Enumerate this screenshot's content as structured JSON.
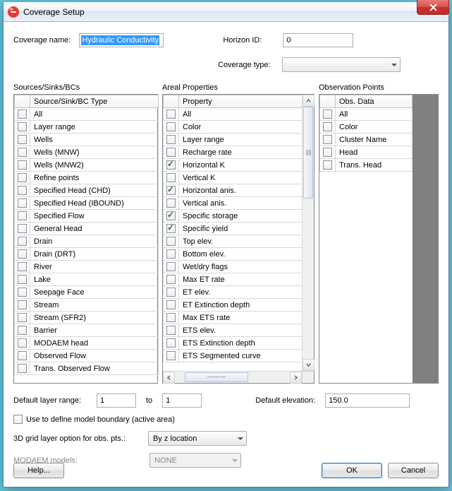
{
  "window": {
    "title": "Coverage Setup"
  },
  "fields": {
    "coverage_name_label": "Coverage name:",
    "coverage_name_value": "Hydraulic Conductivity",
    "horizon_id_label": "Horizon ID:",
    "horizon_id_value": "0",
    "coverage_type_label": "Coverage type:",
    "coverage_type_value": ""
  },
  "sections": {
    "sources": {
      "title": "Sources/Sinks/BCs",
      "header": "Source/Sink/BC Type",
      "items": [
        {
          "label": "All",
          "checked": false
        },
        {
          "label": "Layer range",
          "checked": false
        },
        {
          "label": "Wells",
          "checked": false
        },
        {
          "label": "Wells (MNW)",
          "checked": false
        },
        {
          "label": "Wells (MNW2)",
          "checked": false
        },
        {
          "label": "Refine points",
          "checked": false
        },
        {
          "label": "Specified Head (CHD)",
          "checked": false
        },
        {
          "label": "Specified Head (IBOUND)",
          "checked": false
        },
        {
          "label": "Specified Flow",
          "checked": false
        },
        {
          "label": "General Head",
          "checked": false
        },
        {
          "label": "Drain",
          "checked": false
        },
        {
          "label": "Drain (DRT)",
          "checked": false
        },
        {
          "label": "River",
          "checked": false
        },
        {
          "label": "Lake",
          "checked": false
        },
        {
          "label": "Seepage Face",
          "checked": false
        },
        {
          "label": "Stream",
          "checked": false
        },
        {
          "label": "Stream (SFR2)",
          "checked": false
        },
        {
          "label": "Barrier",
          "checked": false
        },
        {
          "label": "MODAEM head",
          "checked": false
        },
        {
          "label": "Observed Flow",
          "checked": false
        },
        {
          "label": "Trans. Observed Flow",
          "checked": false
        }
      ]
    },
    "areal": {
      "title": "Areal Properties",
      "header": "Property",
      "items": [
        {
          "label": "All",
          "checked": false
        },
        {
          "label": "Color",
          "checked": false
        },
        {
          "label": "Layer range",
          "checked": false
        },
        {
          "label": "Recharge rate",
          "checked": false
        },
        {
          "label": "Horizontal K",
          "checked": true
        },
        {
          "label": "Vertical K",
          "checked": false
        },
        {
          "label": "Horizontal anis.",
          "checked": true
        },
        {
          "label": "Vertical anis.",
          "checked": false
        },
        {
          "label": "Specific storage",
          "checked": true
        },
        {
          "label": "Specific yield",
          "checked": true
        },
        {
          "label": "Top elev.",
          "checked": false
        },
        {
          "label": "Bottom elev.",
          "checked": false
        },
        {
          "label": "Wet/dry flags",
          "checked": false
        },
        {
          "label": "Max ET rate",
          "checked": false
        },
        {
          "label": "ET elev.",
          "checked": false
        },
        {
          "label": "ET Extinction depth",
          "checked": false
        },
        {
          "label": "Max ETS rate",
          "checked": false
        },
        {
          "label": "ETS elev.",
          "checked": false
        },
        {
          "label": "ETS Extinction depth",
          "checked": false
        },
        {
          "label": "ETS Segmented curve",
          "checked": false
        }
      ]
    },
    "obs": {
      "title": "Observation Points",
      "header": "Obs. Data",
      "items": [
        {
          "label": "All",
          "checked": false
        },
        {
          "label": "Color",
          "checked": false
        },
        {
          "label": "Cluster Name",
          "checked": false
        },
        {
          "label": "Head",
          "checked": false
        },
        {
          "label": "Trans. Head",
          "checked": false
        }
      ]
    }
  },
  "bottom": {
    "layer_range_label": "Default layer range:",
    "layer_from": "1",
    "layer_to_label": "to",
    "layer_to": "1",
    "default_elev_label": "Default elevation:",
    "default_elev_value": "150.0",
    "boundary_check_label": "Use to define model boundary (active area)",
    "grid_layer_label": "3D grid layer option for obs. pts.:",
    "grid_layer_value": "By z location",
    "modaem_label": "MODAEM models:",
    "modaem_value": "NONE"
  },
  "buttons": {
    "help": "Help...",
    "ok": "OK",
    "cancel": "Cancel"
  }
}
